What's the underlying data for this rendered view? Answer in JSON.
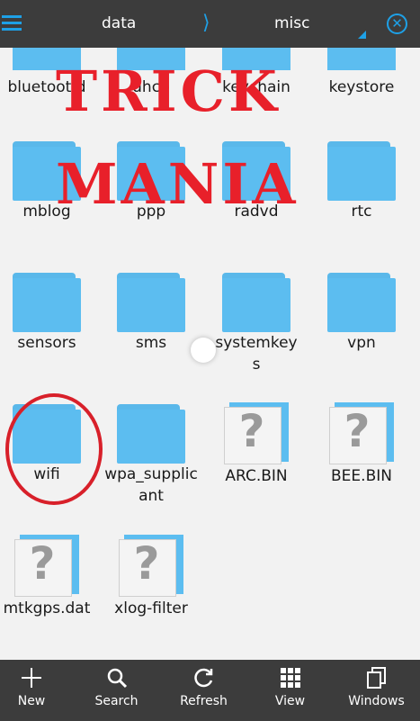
{
  "breadcrumb": {
    "first": "data",
    "separator": "⟩",
    "second": "misc"
  },
  "files": [
    {
      "name": "bluetoothd",
      "type": "folder",
      "visible_label": "bluetoot d"
    },
    {
      "name": "dhcp",
      "type": "folder",
      "visible_label": "dhcp"
    },
    {
      "name": "keychain",
      "type": "folder",
      "visible_label": "keychain"
    },
    {
      "name": "keystore",
      "type": "folder",
      "visible_label": "keystore"
    },
    {
      "name": "mblog",
      "type": "folder",
      "visible_label": "mblog"
    },
    {
      "name": "ppp",
      "type": "folder",
      "visible_label": "ppp"
    },
    {
      "name": "radvd",
      "type": "folder",
      "visible_label": "radvd"
    },
    {
      "name": "rtc",
      "type": "folder",
      "visible_label": "rtc"
    },
    {
      "name": "sensors",
      "type": "folder",
      "visible_label": "sensors"
    },
    {
      "name": "sms",
      "type": "folder",
      "visible_label": "sms"
    },
    {
      "name": "systemkeys",
      "type": "folder",
      "visible_label": "systemkeys"
    },
    {
      "name": "vpn",
      "type": "folder",
      "visible_label": "vpn"
    },
    {
      "name": "wifi",
      "type": "folder",
      "visible_label": "wifi"
    },
    {
      "name": "wpa_supplicant",
      "type": "folder",
      "visible_label": "wpa_supplicant"
    },
    {
      "name": "ARC.BIN",
      "type": "unknown",
      "visible_label": "ARC.BIN"
    },
    {
      "name": "BEE.BIN",
      "type": "unknown",
      "visible_label": "BEE.BIN"
    },
    {
      "name": "mtkgps.dat",
      "type": "unknown",
      "visible_label": "mtkgps.dat"
    },
    {
      "name": "xlog-filter",
      "type": "unknown",
      "visible_label": "xlog-filter"
    }
  ],
  "watermark": {
    "line1": "TRICK",
    "line2": "MANIA"
  },
  "toolbar": {
    "new": "New",
    "search": "Search",
    "refresh": "Refresh",
    "view": "View",
    "windows": "Windows"
  },
  "colors": {
    "accent": "#1ea0e6",
    "folder": "#5cbdf0",
    "bar": "#3c3c3c",
    "watermark": "#e8202a"
  }
}
